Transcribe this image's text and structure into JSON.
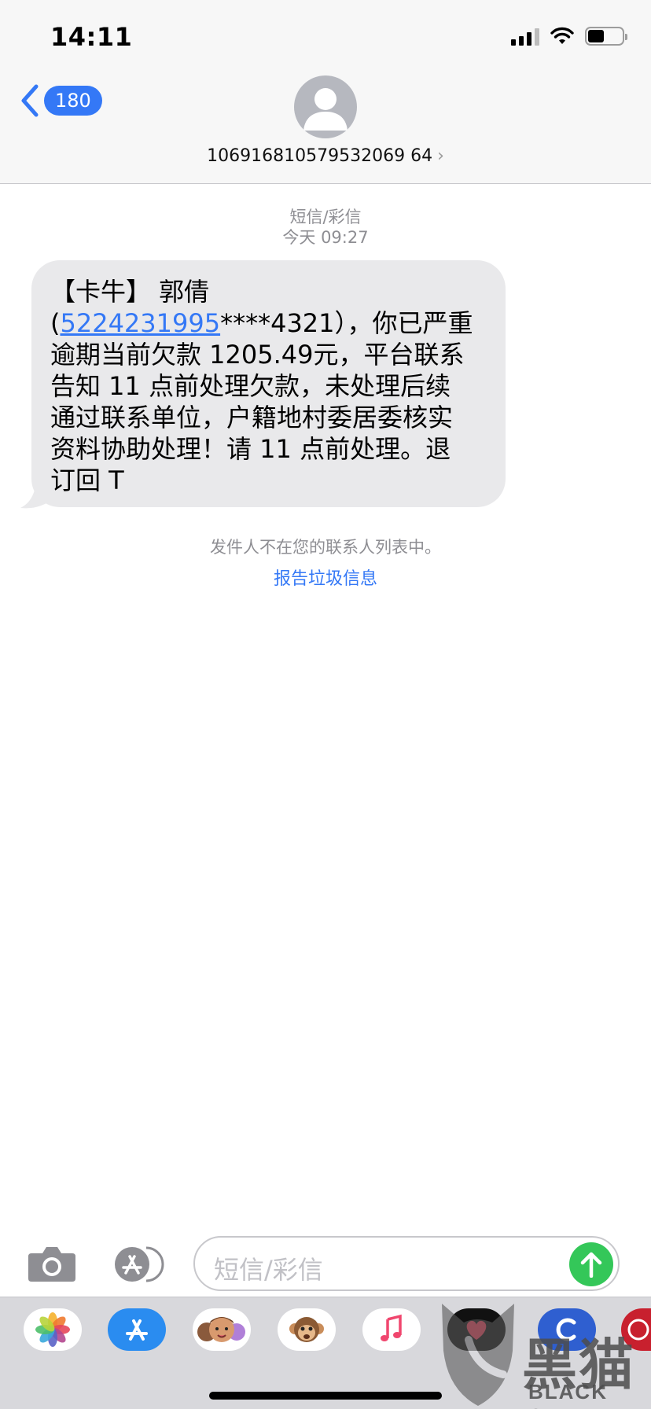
{
  "status_bar": {
    "time": "14:11"
  },
  "nav": {
    "back_count": "180",
    "contact_number": "106916810579532069 64"
  },
  "thread": {
    "channel": "短信/彩信",
    "timestamp": "今天 09:27",
    "message": {
      "line1": "【卡牛】 郭倩",
      "line2_prefix": "(",
      "line2_link": "5224231995",
      "line2_suffix": "****4321），你已严重",
      "line3": "逾期当前欠款 1205.49元，平台联系",
      "line4": "告知 11 点前处理欠款，未处理后续",
      "line5": "通过联系单位，户籍地村委居委核实",
      "line6": "资料协助处理！请 11 点前处理。退",
      "line7": "订回 T"
    },
    "notice": "发件人不在您的联系人列表中。",
    "report_link": "报告垃圾信息"
  },
  "composer": {
    "placeholder": "短信/彩信"
  },
  "app_drawer": {
    "apps": [
      "photos-icon",
      "app-store-icon",
      "memoji-icon",
      "animoji-icon",
      "music-icon",
      "digital-touch-icon",
      "app-c-icon",
      "app-partial-icon"
    ]
  },
  "watermark": {
    "cn": "黑猫",
    "en": "BLACK CAT"
  },
  "colors": {
    "accent": "#3478f6",
    "send": "#34c759",
    "bubble": "#e9e9eb",
    "meta": "#8e8e93"
  }
}
